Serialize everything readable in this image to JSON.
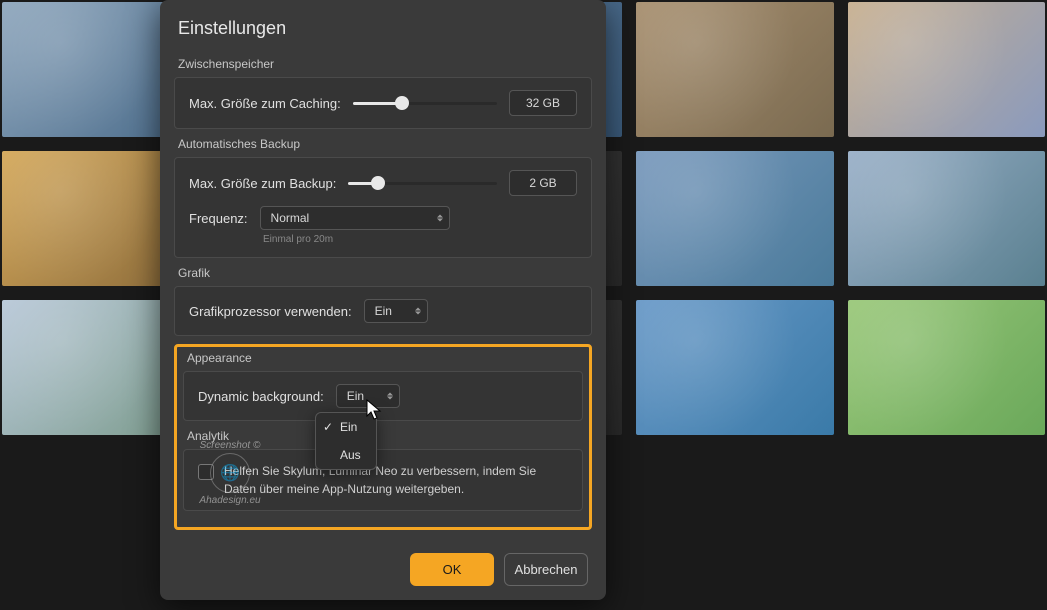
{
  "dialog": {
    "title": "Einstellungen",
    "sec_cache": "Zwischenspeicher",
    "cache_label": "Max. Größe zum Caching:",
    "cache_value": "32 GB",
    "cache_pct": 34,
    "sec_backup": "Automatisches Backup",
    "backup_label": "Max. Größe zum Backup:",
    "backup_value": "2 GB",
    "backup_pct": 20,
    "freq_label": "Frequenz:",
    "freq_value": "Normal",
    "freq_hint": "Einmal pro 20m",
    "sec_graphics": "Grafik",
    "gpu_label": "Grafikprozessor verwenden:",
    "gpu_value": "Ein",
    "sec_appearance": "Appearance",
    "dynbg_label": "Dynamic background:",
    "dynbg_value": "Ein",
    "sec_analytics": "Analytik",
    "analytics_text": "Helfen Sie Skylum, Luminar Neo zu verbessern, indem Sie Daten über meine App-Nutzung weitergeben.",
    "ok": "OK",
    "cancel": "Abbrechen"
  },
  "dropdown": {
    "opt0": "Ein",
    "opt1": "Aus"
  },
  "watermark": {
    "top": "Screenshot ©",
    "bottom": "Ahadesign.eu"
  }
}
